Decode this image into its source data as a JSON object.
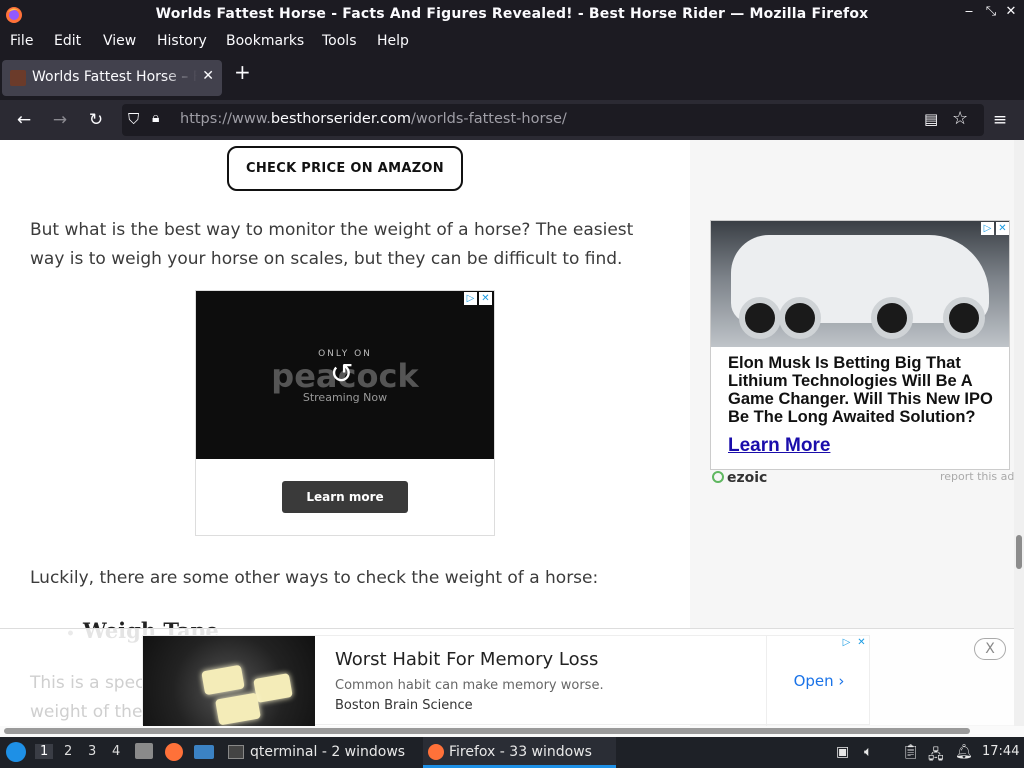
{
  "window": {
    "title": "Worlds Fattest Horse - Facts And Figures Revealed! - Best Horse Rider — Mozilla Firefox"
  },
  "menubar": {
    "items": [
      "File",
      "Edit",
      "View",
      "History",
      "Bookmarks",
      "Tools",
      "Help"
    ]
  },
  "tabs": [
    {
      "title": "Worlds Fattest Horse – Fa"
    }
  ],
  "navbar": {
    "url_prefix": "https://www.",
    "url_domain": "besthorserider.com",
    "url_path": "/worlds-fattest-horse/"
  },
  "content": {
    "amazon_button": "CHECK PRICE ON AMAZON",
    "para1_line1": "But what is the best way to monitor the weight of a horse? The easiest",
    "para1_line2": "way is to weigh your horse on scales, but they can be difficult to find.",
    "ad1": {
      "only_on": "ONLY ON",
      "brand": "peacock",
      "streaming": "Streaming Now",
      "cta": "Learn more"
    },
    "para2": "Luckily, there are some other ways to check the weight of a horse:",
    "bullet": "Weigh Tape",
    "faded_line1": "This is a spec",
    "faded_line2": "weight of the"
  },
  "sidebar_ad": {
    "headline": "Elon Musk Is Betting Big That Lithium Technologies Will Be A Game Changer. Will This New IPO Be The Long Awaited Solution?",
    "cta": "Learn More",
    "ezoic": "ezoic",
    "report": "report this ad"
  },
  "sticky_ad": {
    "headline": "Worst Habit For Memory Loss",
    "sub": "Common habit can make memory worse.",
    "source": "Boston Brain Science",
    "open": "Open",
    "close": "X"
  },
  "taskbar": {
    "workspaces": [
      "1",
      "2",
      "3",
      "4"
    ],
    "tasks": [
      "qterminal - 2 windows",
      "Firefox - 33 windows"
    ],
    "clock": "17:44"
  }
}
